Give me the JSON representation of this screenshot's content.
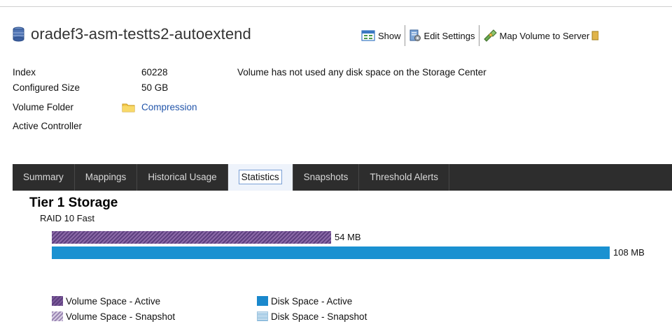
{
  "header": {
    "title": "oradef3-asm-testts2-autoextend",
    "toolbar": [
      {
        "label": "Show",
        "icon": "show-icon"
      },
      {
        "label": "Edit Settings",
        "icon": "edit-settings-icon"
      },
      {
        "label": "Map Volume to Server",
        "icon": "map-volume-icon"
      }
    ]
  },
  "info": {
    "index_label": "Index",
    "index_value": "60228",
    "size_label": "Configured Size",
    "size_value": "50 GB",
    "folder_label": "Volume Folder",
    "folder_value": "Compression",
    "controller_label": "Active Controller",
    "controller_value": "",
    "message": "Volume has not used any disk space on the Storage Center"
  },
  "tabs": [
    {
      "label": "Summary",
      "active": false
    },
    {
      "label": "Mappings",
      "active": false
    },
    {
      "label": "Historical Usage",
      "active": false
    },
    {
      "label": "Statistics",
      "active": true
    },
    {
      "label": "Snapshots",
      "active": false
    },
    {
      "label": "Threshold Alerts",
      "active": false
    }
  ],
  "statistics": {
    "section_title": "Tier 1 Storage",
    "raid_label": "RAID 10 Fast"
  },
  "colors": {
    "volume_active": "#5d3f7f",
    "disk_active": "#1a91d1",
    "tab_bar": "#2d2d2d",
    "link": "#2255aa"
  },
  "chart_data": {
    "type": "bar",
    "title": "Tier 1 Storage",
    "subtitle": "RAID 10 Fast",
    "orientation": "horizontal",
    "categories": [
      "Volume Space - Active",
      "Disk Space - Active"
    ],
    "values": [
      54,
      108
    ],
    "value_labels": [
      "54 MB",
      "108 MB"
    ],
    "unit": "MB",
    "xlim": [
      0,
      108
    ],
    "grid": false,
    "legend_position": "bottom-left",
    "legend": [
      {
        "name": "Volume Space - Active",
        "color": "#5d3f7f",
        "pattern": "hatched"
      },
      {
        "name": "Volume Space - Snapshot",
        "color": "#9a86b3",
        "pattern": "hatched-light"
      },
      {
        "name": "Disk Space - Active",
        "color": "#1a88cc",
        "pattern": "solid"
      },
      {
        "name": "Disk Space - Snapshot",
        "color": "#7fb6db",
        "pattern": "dotted"
      }
    ]
  }
}
